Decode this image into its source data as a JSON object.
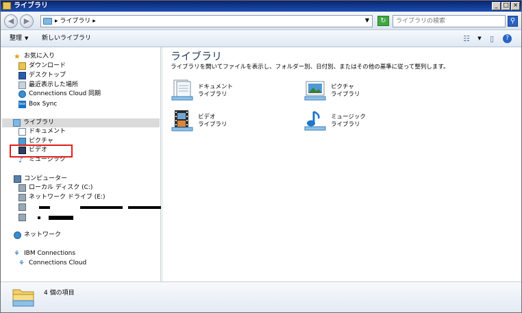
{
  "window": {
    "title": "ライブラリ",
    "min_label": "_",
    "max_label": "□",
    "close_label": "×"
  },
  "nav": {
    "back_glyph": "◀",
    "forward_glyph": "▶"
  },
  "address": {
    "crumb": "▸ ライブラリ ▸",
    "dropdown": "▼",
    "refresh_glyph": "↻"
  },
  "search": {
    "placeholder": "ライブラリの検索",
    "button_glyph": "⚲"
  },
  "toolbar": {
    "organize": "整理",
    "organize_arrow": "▼",
    "new_library": "新しいライブラリ",
    "views_glyph": "☷",
    "views_arrow": "▼",
    "preview_glyph": "▯",
    "help_glyph": "?"
  },
  "sidebar": {
    "favorites": {
      "label": "お気に入り",
      "items": [
        {
          "label": "ダウンロード",
          "icon": "download-folder-icon"
        },
        {
          "label": "デスクトップ",
          "icon": "desktop-icon"
        },
        {
          "label": "最近表示した場所",
          "icon": "recent-places-icon"
        },
        {
          "label": "Connections Cloud 同期",
          "icon": "connections-sync-icon"
        },
        {
          "label": "Box Sync",
          "icon": "box-sync-icon"
        }
      ]
    },
    "libraries": {
      "label": "ライブラリ",
      "items": [
        {
          "label": "ドキュメント",
          "icon": "documents-icon"
        },
        {
          "label": "ピクチャ",
          "icon": "pictures-icon"
        },
        {
          "label": "ビデオ",
          "icon": "videos-icon"
        },
        {
          "label": "ミュージック",
          "icon": "music-icon"
        }
      ]
    },
    "computer": {
      "label": "コンピューター",
      "items": [
        {
          "label": "ローカル ディスク (C:)",
          "icon": "local-disk-icon"
        },
        {
          "label": "ネットワーク ドライブ (E:)",
          "icon": "network-drive-icon"
        }
      ]
    },
    "network": {
      "label": "ネットワーク"
    },
    "ibm": {
      "label": "IBM Connections",
      "items": [
        {
          "label": "Connections Cloud",
          "icon": "connections-cloud-icon"
        }
      ]
    }
  },
  "main": {
    "title": "ライブラリ",
    "description": "ライブラリを開いてファイルを表示し、フォルダー別、日付別、またはその他の基準に従って整列します。",
    "libraries": [
      {
        "name": "ドキュメント",
        "sub": "ライブラリ",
        "icon": "documents-library-icon"
      },
      {
        "name": "ピクチャ",
        "sub": "ライブラリ",
        "icon": "pictures-library-icon"
      },
      {
        "name": "ビデオ",
        "sub": "ライブラリ",
        "icon": "videos-library-icon"
      },
      {
        "name": "ミュージック",
        "sub": "ライブラリ",
        "icon": "music-library-icon"
      }
    ]
  },
  "status": {
    "text": "4 個の項目"
  },
  "colors": {
    "title_bar": "#0a246a",
    "highlight_box": "#e01b1b",
    "selected_row": "#dadada",
    "library_heading": "#1e395b"
  }
}
